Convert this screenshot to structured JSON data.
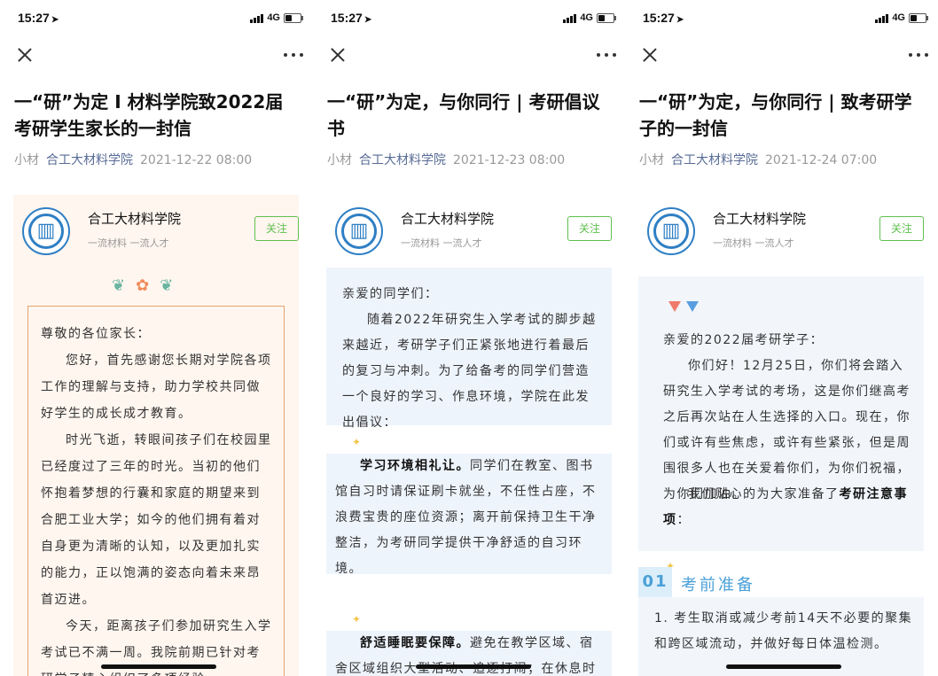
{
  "status": {
    "time": "15:27",
    "network": "4G"
  },
  "account": {
    "name": "合工大材料学院",
    "slogan": "一流材料 一流人才",
    "follow": "关注"
  },
  "panels": [
    {
      "title": "一“研”为定 I 材料学院致2022届考研学生家长的一封信",
      "author": "小材",
      "source": "合工大材料学院",
      "date": "2021-12-22 08:00",
      "salutation": "尊敬的各位家长：",
      "paragraphs": [
        "您好，首先感谢您长期对学院各项工作的理解与支持，助力学校共同做好学生的成长成才教育。",
        "时光飞逝，转眼间孩子们在校园里已经度过了三年的时光。当初的他们怀抱着梦想的行囊和家庭的期望来到合肥工业大学；如今的他们拥有着对自身更为清晰的认知，以及更加扎实的能力，正以饱满的姿态向着未来昂首迈进。",
        "今天，距离孩子们参加研究生入学考试已不满一周。我院前期已针对考研学子精心组织了多项经验"
      ]
    },
    {
      "title": "一“研”为定，与你同行 | 考研倡议书",
      "author": "小材",
      "source": "合工大材料学院",
      "date": "2021-12-23 08:00",
      "salutation": "亲爱的同学们：",
      "intro": "随着2022年研究生入学考试的脚步越来越近，考研学子们正紧张地进行着最后的复习与冲刺。为了给备考的同学们营造一个良好的学习、作息环境，学院在此发出倡议：",
      "items": [
        {
          "bold": "学习环境相礼让。",
          "text": "同学们在教室、图书馆自习时请保证刷卡就坐，不任性占座，不浪费宝贵的座位资源；离开前保持卫生干净整洁，为考研同学提供干净舒适的自习环境。"
        },
        {
          "bold": "舒适睡眠要保障。",
          "text": "避免在教学区域、宿舍区域组织大型活动、追逐打闹；在休息时间"
        }
      ]
    },
    {
      "title": "一“研”为定，与你同行 | 致考研学子的一封信",
      "author": "小材",
      "source": "合工大材料学院",
      "date": "2021-12-24 07:00",
      "salutation": "亲爱的2022届考研学子：",
      "paragraphs": [
        "你们好！12月25日，你们将会踏入研究生入学考试的考场，这是你们继高考之后再次站在人生选择的入口。现在，你们或许有些焦虑，或许有些紧张，但是周围很多人也在关爱着你们，为你们祝福，为你们加油。",
        "我们贴心的为大家准备了"
      ],
      "notice_bold": "考研注意事项",
      "notice_tail": "：",
      "section_num": "01",
      "section_label": "考前准备",
      "section_item": "1. 考生取消或减少考前14天不必要的聚集和跨区域流动，并做好每日体温检测。"
    }
  ],
  "colors": {
    "accent_blue": "#576b95",
    "follow_green": "#5fbf4f",
    "section_blue": "#4aa0d8",
    "letter_border": "#e7a26c"
  }
}
